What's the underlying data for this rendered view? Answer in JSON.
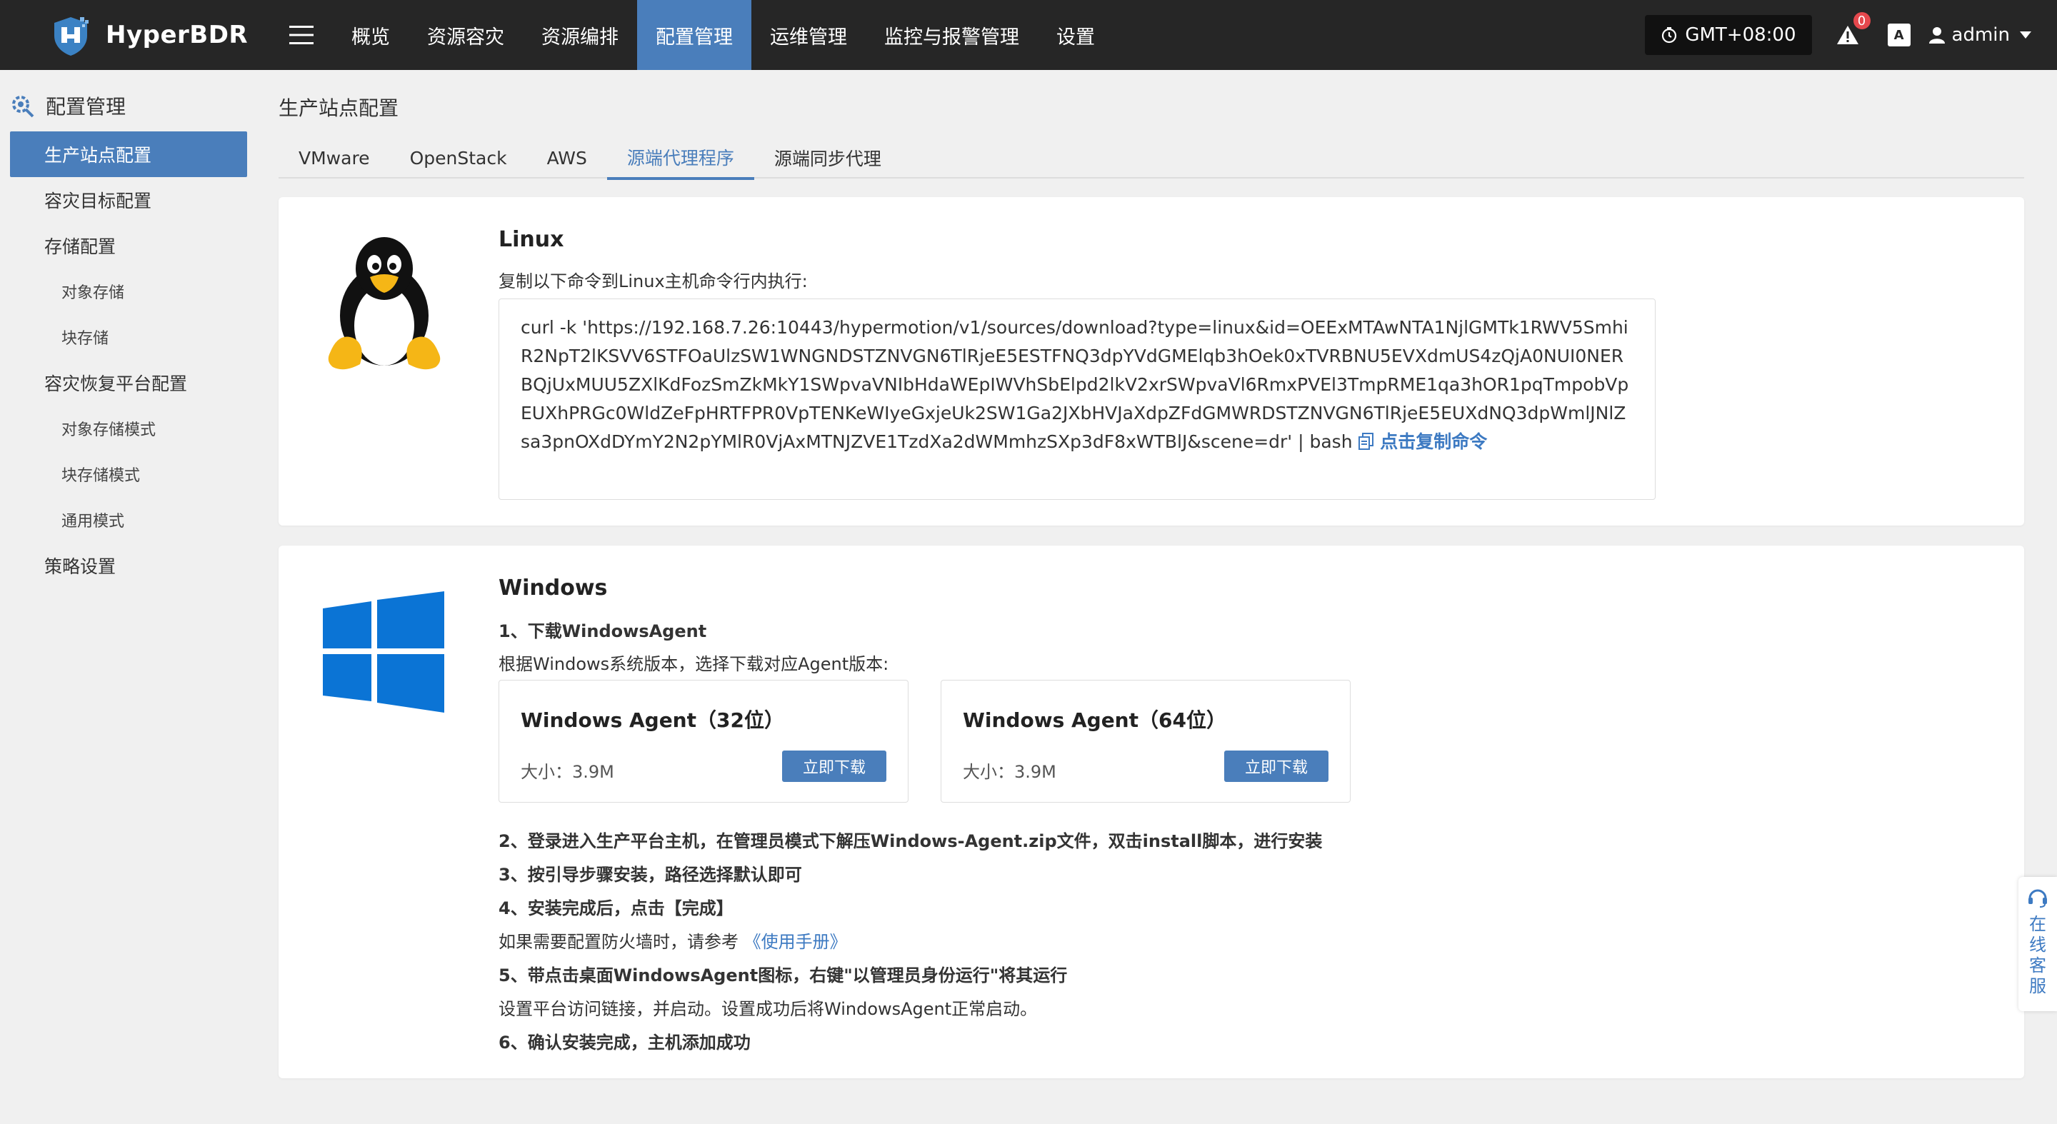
{
  "app": {
    "name": "HyperBDR"
  },
  "nav": {
    "items": [
      {
        "label": "概览"
      },
      {
        "label": "资源容灾"
      },
      {
        "label": "资源编排"
      },
      {
        "label": "配置管理"
      },
      {
        "label": "运维管理"
      },
      {
        "label": "监控与报警管理"
      },
      {
        "label": "设置"
      }
    ],
    "active_index": 3
  },
  "topbar": {
    "timezone": "GMT+08:00",
    "alert_count": "0",
    "lang_label": "A",
    "user": "admin"
  },
  "sidebar": {
    "title": "配置管理",
    "items": [
      {
        "label": "生产站点配置"
      },
      {
        "label": "容灾目标配置"
      },
      {
        "label": "存储配置"
      },
      {
        "label": "对象存储"
      },
      {
        "label": "块存储"
      },
      {
        "label": "容灾恢复平台配置"
      },
      {
        "label": "对象存储模式"
      },
      {
        "label": "块存储模式"
      },
      {
        "label": "通用模式"
      },
      {
        "label": "策略设置"
      }
    ]
  },
  "page": {
    "title": "生产站点配置",
    "tabs": [
      {
        "label": "VMware"
      },
      {
        "label": "OpenStack"
      },
      {
        "label": "AWS"
      },
      {
        "label": "源端代理程序"
      },
      {
        "label": "源端同步代理"
      }
    ]
  },
  "linux": {
    "title": "Linux",
    "instruction": "复制以下命令到Linux主机命令行内执行:",
    "command": "curl -k 'https://192.168.7.26:10443/hypermotion/v1/sources/download?type=linux&id=OEExMTAwNTA1NjlGMTk1RWV5SmhiR2NpT2lKSVV6STFOaUlzSW1WNGNDSTZNVGN6TlRjeE5ESTFNQ3dpYVdGMElqb3hOek0xTVRBNU5EVXdmUS4zQjA0NUI0NERBQjUxMUU5ZXlKdFozSmZkMkY1SWpvaVNIbHdaWEpIWVhSbElpd2lkV2xrSWpvaVl6RmxPVEl3TmpRME1qa3hOR1pqTmpobVpEUXhPRGc0WldZeFpHRTFPR0VpTENKeWIyeGxjeUk2SW1Ga2JXbHVJaXdpZFdGMWRDSTZNVGN6TlRjeE5EUXdNQ3dpWmlJNlZsa3pnOXdDYmY2N2pYMlR0VjAxMTNJZVE1TzdXa2dWMmhzSXp3dF8xWTBlJ&scene=dr' | bash",
    "copy_label": "点击复制命令"
  },
  "windows": {
    "title": "Windows",
    "step1": "1、下载WindowsAgent",
    "step1_desc": "根据Windows系统版本，选择下载对应Agent版本:",
    "agents": [
      {
        "name": "Windows Agent（32位）",
        "size": "大小：3.9M",
        "button": "立即下载"
      },
      {
        "name": "Windows Agent（64位）",
        "size": "大小：3.9M",
        "button": "立即下载"
      }
    ],
    "step2": "2、登录进入生产平台主机，在管理员模式下解压Windows-Agent.zip文件，双击install脚本，进行安装",
    "step3": "3、按引导步骤安装，路径选择默认即可",
    "step4": "4、安装完成后，点击【完成】",
    "firewall_note": "如果需要配置防火墙时，请参考",
    "manual_link": "《使用手册》",
    "step5": "5、带点击桌面WindowsAgent图标，右键\"以管理员身份运行\"将其运行",
    "step5_desc": "设置平台访问链接，并启动。设置成功后将WindowsAgent正常启动。",
    "step6": "6、确认安装完成，主机添加成功"
  },
  "support": {
    "label": "在线客服"
  },
  "colors": {
    "accent": "#4a7ebb",
    "topbar": "#262626",
    "link": "#3d7ac2",
    "windows_blue": "#0b74d5"
  }
}
